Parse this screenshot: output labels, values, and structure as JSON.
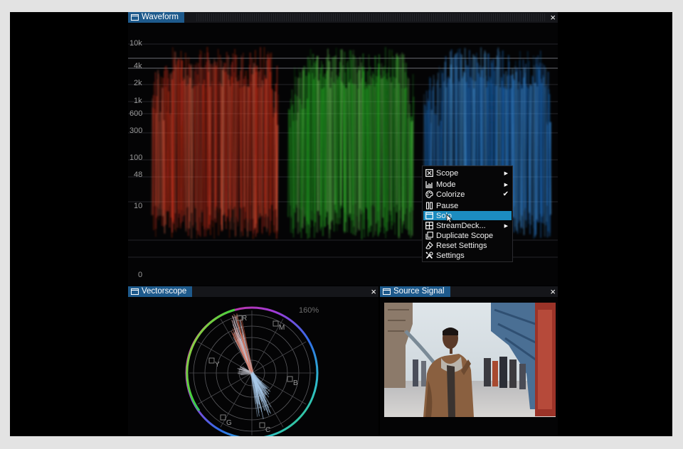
{
  "waveform": {
    "title": "Waveform",
    "close_label": "×",
    "scale_labels": [
      "10k",
      "4k",
      "2k",
      "1k",
      "600",
      "300",
      "100",
      "48",
      "10",
      "0"
    ]
  },
  "context_menu": {
    "items": [
      {
        "label": "Scope",
        "icon": "scope-icon",
        "submenu": true
      },
      {
        "label": "Mode",
        "icon": "mode-icon",
        "submenu": true
      },
      {
        "label": "Colorize",
        "icon": "palette-icon",
        "checked": true
      },
      {
        "label": "Pause",
        "icon": "pause-icon"
      },
      {
        "label": "Solo",
        "icon": "solo-icon",
        "highlighted": true
      },
      {
        "label": "StreamDeck...",
        "icon": "grid-icon",
        "submenu": true
      },
      {
        "label": "Duplicate Scope",
        "icon": "duplicate-icon"
      },
      {
        "label": "Reset Settings",
        "icon": "eraser-icon"
      },
      {
        "label": "Settings",
        "icon": "tools-icon"
      }
    ]
  },
  "vectorscope": {
    "title": "Vectorscope",
    "close_label": "×",
    "zoom_label": "160%",
    "targets": [
      "R",
      "M",
      "B",
      "C",
      "G",
      "Y"
    ]
  },
  "source_signal": {
    "title": "Source Signal",
    "close_label": "×"
  },
  "colors": {
    "tab_blue": "#1e5a8c",
    "highlight": "#1c8cc0",
    "red_channel": "#e8341c",
    "green_channel": "#2ccc2a",
    "blue_channel": "#1f7ee0"
  }
}
